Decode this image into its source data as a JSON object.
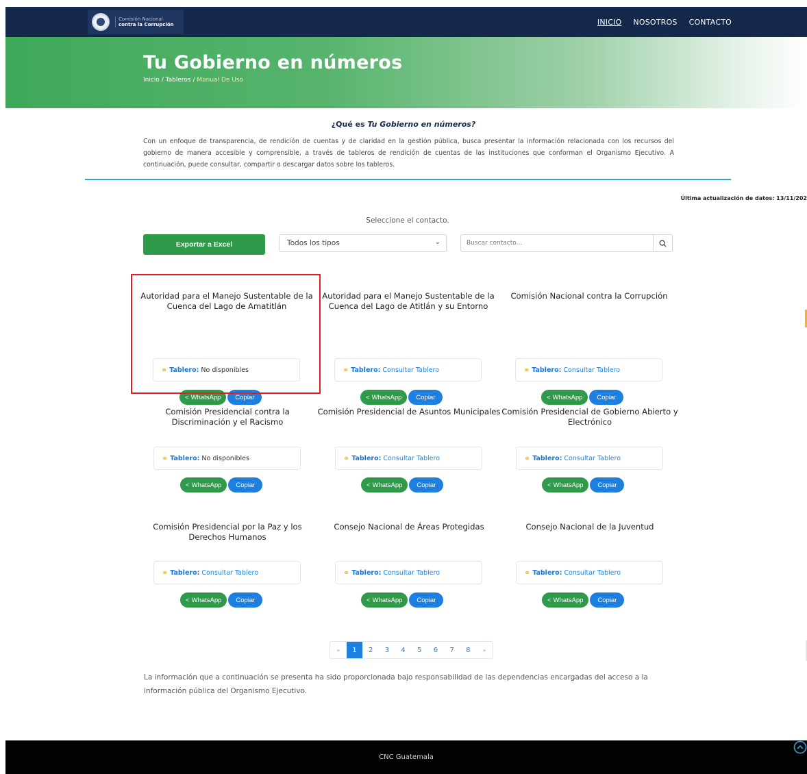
{
  "header": {
    "logo": {
      "line1": "Comisión Nacional",
      "line2": "contra la Corrupción"
    },
    "nav": [
      {
        "label": "INICIO",
        "active": true
      },
      {
        "label": "NOSOTROS",
        "active": false
      },
      {
        "label": "CONTACTO",
        "active": false
      }
    ]
  },
  "hero": {
    "title": "Tu Gobierno en números",
    "breadcrumb": {
      "home": "Inicio",
      "sep1": " / ",
      "middle": "Tableros",
      "sep2": " / ",
      "current": "Manual De Uso"
    }
  },
  "intro": {
    "title_prefix": "¿Qué es ",
    "title_em": "Tu Gobierno en números?",
    "text": "Con un enfoque de transparencia, de rendición de cuentas y de claridad en la gestión pública, busca presentar la información relacionada con los recursos del gobierno de manera accesible y comprensible, a través de tableros de rendición de cuentas de las instituciones que conforman el Organismo Ejecutivo. A continuación, puede consultar, compartir o descargar datos sobre los tableros."
  },
  "last_update": "Última actualización de datos: 13/11/202",
  "controls": {
    "select_label": "Seleccione el contacto.",
    "export_label": "Exportar a Excel",
    "type_select_value": "Todos los tipos",
    "search_placeholder": "Buscar contacto..."
  },
  "cards": [
    {
      "name": "Autoridad para el Manejo Sustentable de la Cuenca del Lago de Amatitlán",
      "tablero_label": "Tablero:",
      "tablero_value": "No disponibles",
      "available": false,
      "whatsapp": "WhatsApp",
      "copy": "Copiar"
    },
    {
      "name": "Autoridad para el Manejo Sustentable de la Cuenca del Lago de Atitlán y su Entorno",
      "tablero_label": "Tablero:",
      "tablero_value": "Consultar Tablero",
      "available": true,
      "whatsapp": "WhatsApp",
      "copy": "Copiar"
    },
    {
      "name": "Comisión Nacional contra la Corrupción",
      "tablero_label": "Tablero:",
      "tablero_value": "Consultar Tablero",
      "available": true,
      "whatsapp": "WhatsApp",
      "copy": "Copiar"
    },
    {
      "name": "Comisión Presidencial contra la Discriminación y el Racismo",
      "tablero_label": "Tablero:",
      "tablero_value": "No disponibles",
      "available": false,
      "whatsapp": "WhatsApp",
      "copy": "Copiar"
    },
    {
      "name": "Comisión Presidencial de Asuntos Municipales",
      "tablero_label": "Tablero:",
      "tablero_value": "Consultar Tablero",
      "available": true,
      "whatsapp": "WhatsApp",
      "copy": "Copiar"
    },
    {
      "name": "Comisión Presidencial de Gobierno Abierto y Electrónico",
      "tablero_label": "Tablero:",
      "tablero_value": "Consultar Tablero",
      "available": true,
      "whatsapp": "WhatsApp",
      "copy": "Copiar"
    },
    {
      "name": "Comisión Presidencial por la Paz y los Derechos Humanos",
      "tablero_label": "Tablero:",
      "tablero_value": "Consultar Tablero",
      "available": true,
      "whatsapp": "WhatsApp",
      "copy": "Copiar"
    },
    {
      "name": "Consejo Nacional de Áreas Protegidas",
      "tablero_label": "Tablero:",
      "tablero_value": "Consultar Tablero",
      "available": true,
      "whatsapp": "WhatsApp",
      "copy": "Copiar"
    },
    {
      "name": "Consejo Nacional de la Juventud",
      "tablero_label": "Tablero:",
      "tablero_value": "Consultar Tablero",
      "available": true,
      "whatsapp": "WhatsApp",
      "copy": "Copiar"
    }
  ],
  "pagination": {
    "prev": "«",
    "pages": [
      "1",
      "2",
      "3",
      "4",
      "5",
      "6",
      "7",
      "8"
    ],
    "active_page": "1",
    "next": "»"
  },
  "disclaimer": "La información que a continuación se presenta ha sido proporcionada bajo responsabilidad de las dependencias encargadas del acceso a la información pública del Organismo Ejecutivo.",
  "footer": {
    "text": "CNC Guatemala"
  },
  "colors": {
    "navbar": "#14284b",
    "green": "#2f9a49",
    "blue": "#1d7fe0",
    "highlight": "#e02020"
  }
}
